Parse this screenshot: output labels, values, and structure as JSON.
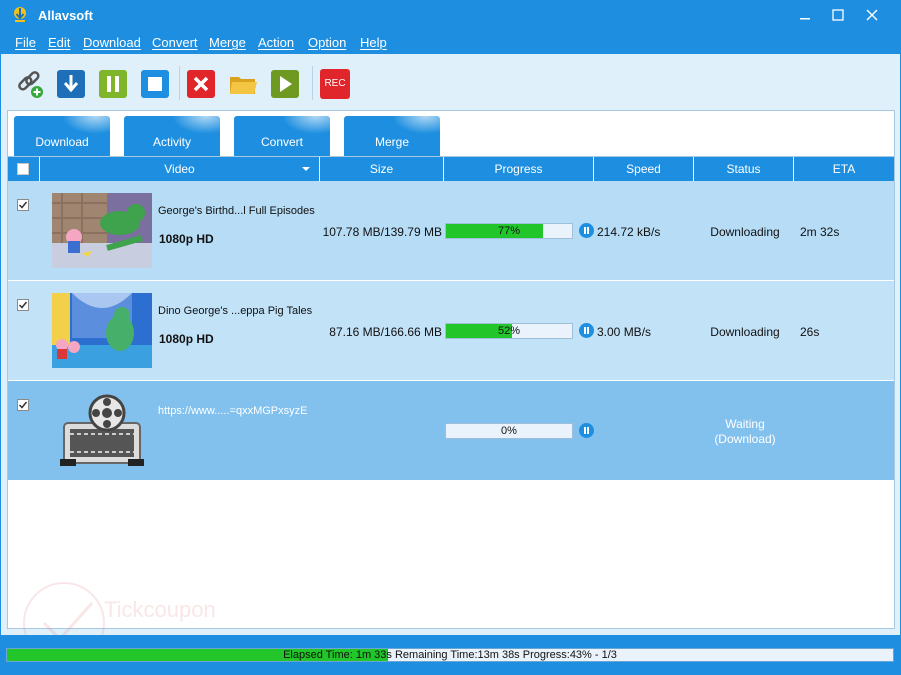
{
  "window": {
    "title": "Allavsoft",
    "accent_color": "#1e8fe0",
    "controls": [
      "minimize-icon",
      "maximize-icon",
      "close-icon"
    ]
  },
  "menu": [
    "File",
    "Edit",
    "Download",
    "Convert",
    "Merge",
    "Action",
    "Option",
    "Help"
  ],
  "toolbar": {
    "icons": [
      "add-url-icon",
      "download-icon",
      "pause-all-icon",
      "stop-icon",
      "delete-icon",
      "open-folder-icon",
      "play-icon",
      "record-icon"
    ],
    "rec_label": "REC"
  },
  "tabs": [
    "Download",
    "Activity",
    "Convert",
    "Merge"
  ],
  "table": {
    "columns": [
      "Video",
      "Size",
      "Progress",
      "Speed",
      "Status",
      "ETA"
    ],
    "rows": [
      {
        "checked": true,
        "title": "George's Birthd...l Full Episodes",
        "quality": "1080p HD",
        "size": "107.78 MB/139.79 MB",
        "progress_text": "77%",
        "progress": 0.77,
        "speed": "214.72 kB/s",
        "status": "Downloading",
        "eta": "2m 32s"
      },
      {
        "checked": true,
        "title": "Dino George's ...eppa Pig Tales",
        "quality": "1080p HD",
        "size": "87.16 MB/166.66 MB",
        "progress_text": "52%",
        "progress": 0.52,
        "speed": "3.00 MB/s",
        "status": "Downloading",
        "eta": "26s"
      },
      {
        "checked": true,
        "url": "https://www.....=qxxMGPxsyzE",
        "progress_text": "0%",
        "progress": 0,
        "status_line1": "Waiting",
        "status_line2": "(Download)"
      }
    ]
  },
  "statusbar": {
    "text": "Elapsed Time:  1m 33s Remaining Time:13m 38s Progress:43% - 1/3",
    "progress": 0.43
  },
  "watermark": {
    "text": "Tickcoupon"
  }
}
